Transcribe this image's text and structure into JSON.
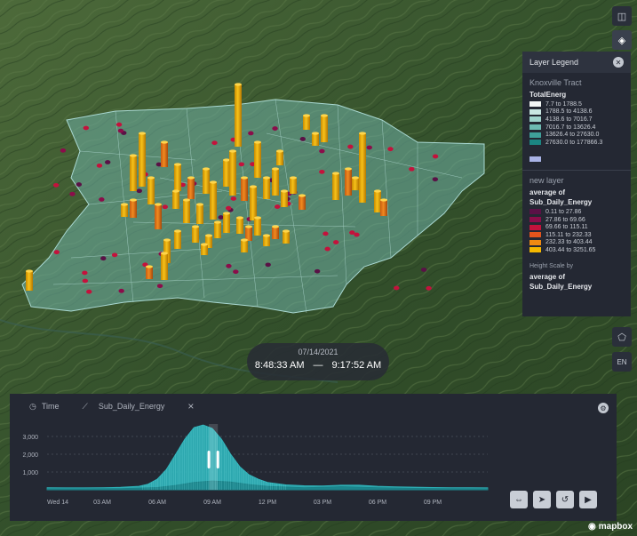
{
  "map": {
    "colors": {
      "terrain": "#3a5a30",
      "tract": "#6fb0a6"
    }
  },
  "toolbar_right": {
    "buttons": [
      {
        "name": "split-view-icon",
        "glyph": "◫"
      },
      {
        "name": "layers-icon",
        "glyph": "◈"
      },
      {
        "name": "draw-polygon-icon",
        "glyph": "⬠"
      },
      {
        "name": "locale-button",
        "glyph": "EN"
      }
    ]
  },
  "legend": {
    "title": "Layer Legend",
    "layer1": {
      "name": "Knoxville Tract",
      "field": "TotalEnerg",
      "items": [
        {
          "label": "7.7 to 1788.5",
          "color": "#f2f5f4"
        },
        {
          "label": "1788.5 to 4138.6",
          "color": "#c9e6e2"
        },
        {
          "label": "4138.6 to 7016.7",
          "color": "#9fd3cc"
        },
        {
          "label": "7016.7 to 13626.4",
          "color": "#6dbab2"
        },
        {
          "label": "13626.4 to 27630.0",
          "color": "#3fa09a"
        },
        {
          "label": "27630.0 to 177866.3",
          "color": "#1b8682"
        }
      ],
      "extra_swatch_color": "#a9b3e6"
    },
    "layer2": {
      "name": "new layer",
      "agg": "average of",
      "field": "Sub_Daily_Energy",
      "items": [
        {
          "label": "0.11 to 27.86",
          "color": "#5a1146"
        },
        {
          "label": "27.86 to 69.66",
          "color": "#8b0d4a"
        },
        {
          "label": "69.66 to 115.11",
          "color": "#c4123c"
        },
        {
          "label": "115.11 to 232.33",
          "color": "#e3541c"
        },
        {
          "label": "232.33 to 403.44",
          "color": "#ef8a12"
        },
        {
          "label": "403.44 to 3251.65",
          "color": "#f5b800"
        }
      ]
    },
    "height": {
      "title": "Height Scale by",
      "agg": "average of",
      "field": "Sub_Daily_Energy"
    }
  },
  "time_display": {
    "date": "07/14/2021",
    "start": "8:48:33 AM",
    "separator": "—",
    "end": "9:17:52 AM"
  },
  "timeline": {
    "tab_time": "Time",
    "tab_field": "Sub_Daily_Energy",
    "close": "×"
  },
  "chart_data": {
    "type": "area",
    "title": "",
    "xlabel": "",
    "ylabel": "",
    "ylim": [
      0,
      3700
    ],
    "grid": true,
    "y_ticks": [
      1000,
      2000,
      3000
    ],
    "y_tick_labels": [
      "1,000",
      "2,000",
      "3,000"
    ],
    "x_ticks": [
      0,
      3,
      6,
      9,
      12,
      15,
      18,
      21
    ],
    "x_tick_labels": [
      "Wed 14",
      "03 AM",
      "06 AM",
      "09 AM",
      "12 PM",
      "03 PM",
      "06 PM",
      "09 PM"
    ],
    "x_range": [
      0,
      24
    ],
    "selection": [
      8.81,
      9.3
    ],
    "series": [
      {
        "color": "#2fb6bd",
        "x": [
          0,
          1,
          2,
          3,
          4,
          5,
          5.5,
          6,
          6.5,
          7,
          7.5,
          8,
          8.5,
          9,
          9.5,
          10,
          10.5,
          11,
          11.5,
          12,
          13,
          14,
          15,
          16,
          17,
          18,
          19,
          20,
          21,
          22,
          23,
          24
        ],
        "values": [
          120,
          110,
          110,
          120,
          140,
          200,
          320,
          600,
          1150,
          2000,
          2850,
          3500,
          3650,
          3450,
          2850,
          2000,
          1300,
          850,
          600,
          420,
          280,
          230,
          220,
          260,
          260,
          200,
          170,
          150,
          130,
          120,
          115,
          110
        ]
      },
      {
        "color": "#1a7f86",
        "x": [
          0,
          2,
          4,
          6,
          7,
          8,
          9,
          10,
          11,
          12,
          14,
          15,
          16,
          18,
          20,
          22,
          24
        ],
        "values": [
          60,
          60,
          70,
          130,
          250,
          420,
          500,
          440,
          300,
          200,
          120,
          140,
          180,
          120,
          80,
          70,
          60
        ]
      }
    ]
  },
  "controls": [
    {
      "name": "loop-button",
      "glyph": "⇔"
    },
    {
      "name": "speed-button",
      "glyph": "➤"
    },
    {
      "name": "reset-button",
      "glyph": "↺"
    },
    {
      "name": "play-button",
      "glyph": "▶"
    }
  ],
  "attribution": {
    "brand": "mapbox",
    "logo_glyph": "◉"
  }
}
